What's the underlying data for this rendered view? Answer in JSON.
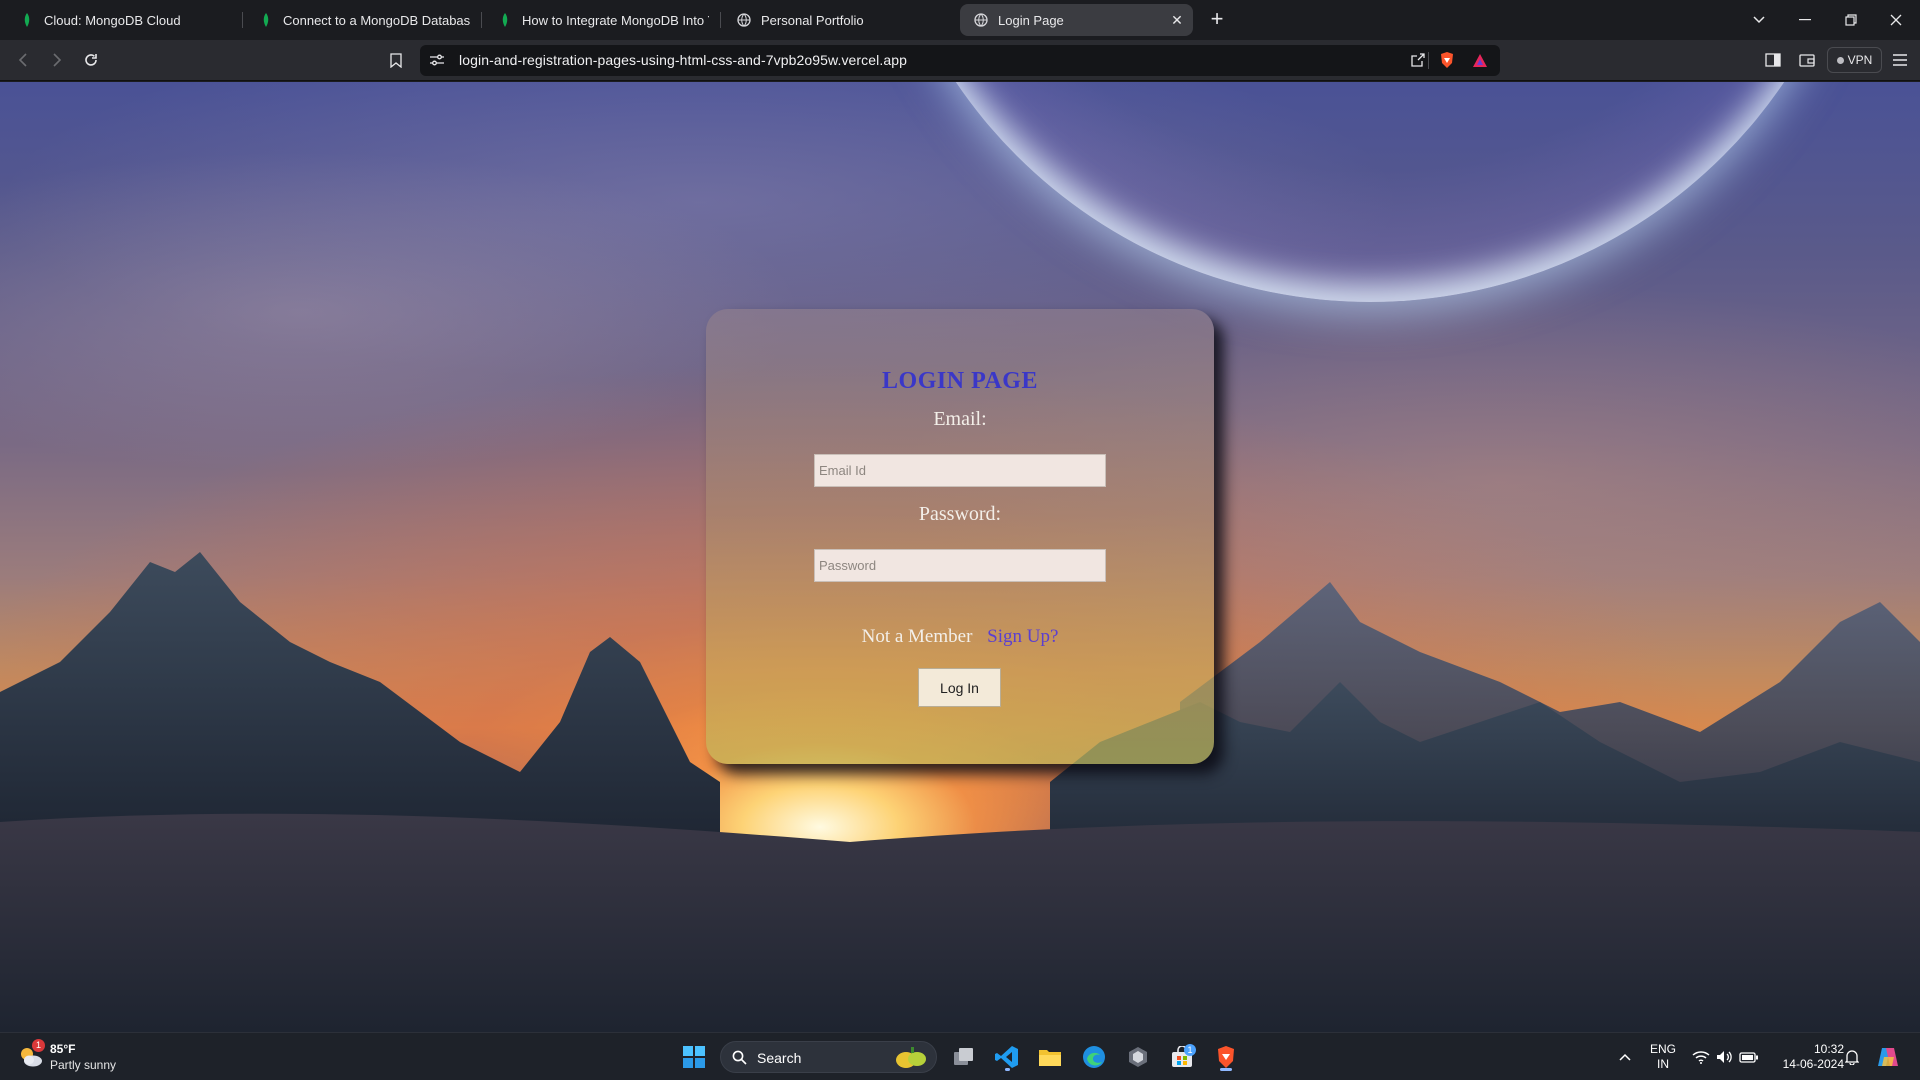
{
  "browser": {
    "tabs": [
      {
        "title": "Cloud: MongoDB Cloud",
        "favicon": "mongodb-leaf-icon",
        "active": false
      },
      {
        "title": "Connect to a MongoDB Database Us",
        "favicon": "mongodb-leaf-icon",
        "active": false
      },
      {
        "title": "How to Integrate MongoDB Into You",
        "favicon": "mongodb-leaf-icon",
        "active": false
      },
      {
        "title": "Personal Portfolio",
        "favicon": "globe-icon",
        "active": false
      },
      {
        "title": "Login Page",
        "favicon": "globe-icon",
        "active": true
      }
    ],
    "url": "login-and-registration-pages-using-html-css-and-7vpb2o95w.vercel.app",
    "vpn_label": "VPN"
  },
  "login": {
    "title": "LOGIN PAGE",
    "email_label": "Email:",
    "email_placeholder": "Email Id",
    "password_label": "Password:",
    "password_placeholder": "Password",
    "not_member_text": "Not a Member",
    "signup_link": "Sign Up?",
    "login_button": "Log In"
  },
  "taskbar": {
    "weather_temp": "85°F",
    "weather_desc": "Partly sunny",
    "weather_badge": "1",
    "search_label": "Search",
    "store_badge": "1",
    "lang_line1": "ENG",
    "lang_line2": "IN",
    "time": "10:32",
    "date": "14-06-2024"
  },
  "colors": {
    "title_blue": "#3a37c8",
    "signup_purple": "#5b3fd0",
    "tab_active_bg": "#3b3c41",
    "taskbar_bg": "#1e2229"
  }
}
